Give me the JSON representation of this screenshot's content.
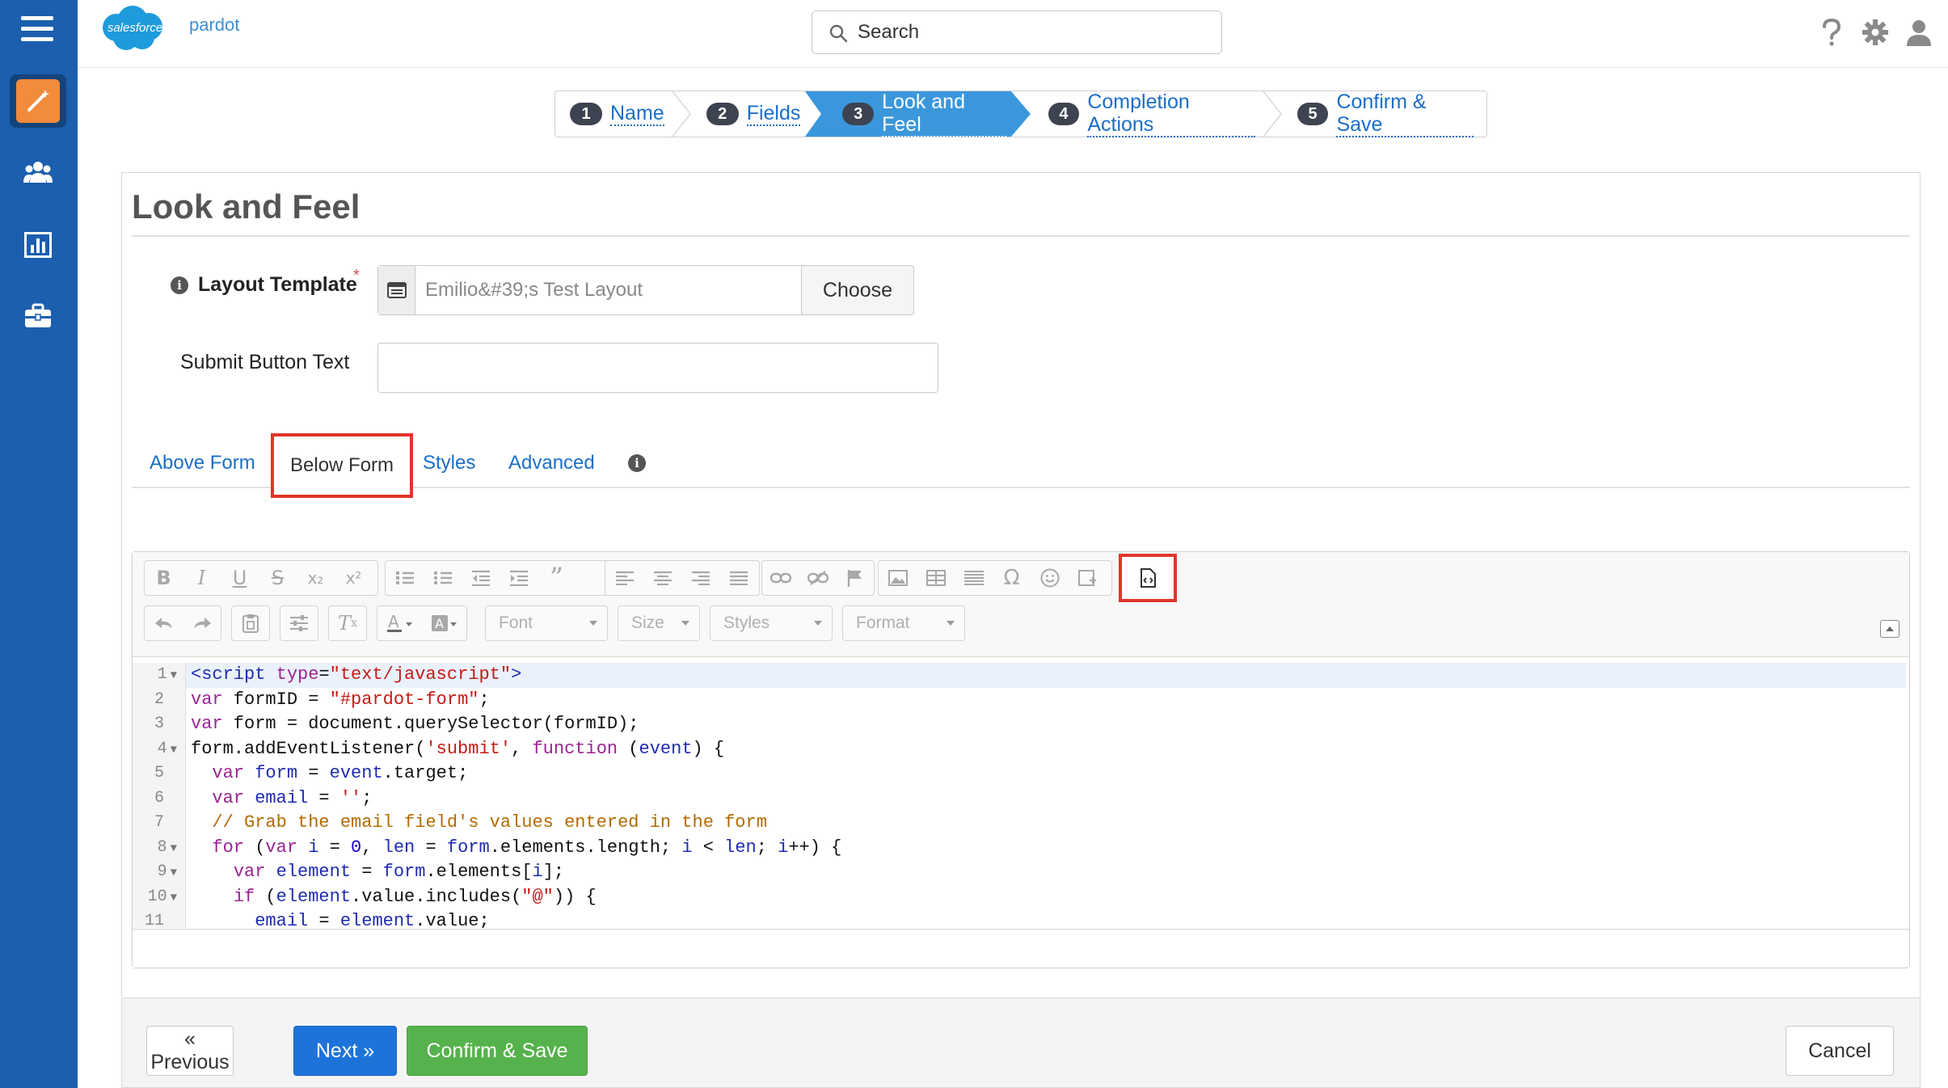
{
  "sidebar": {
    "items": [
      {
        "icon": "wand-icon",
        "active": true
      },
      {
        "icon": "users-icon",
        "active": false
      },
      {
        "icon": "bar-chart-icon",
        "active": false
      },
      {
        "icon": "briefcase-icon",
        "active": false
      }
    ]
  },
  "header": {
    "logo_cloud_text": "salesforce",
    "logo_brand": "pardot",
    "search_placeholder": "Search"
  },
  "wizard": {
    "steps": [
      {
        "num": "1",
        "label": "Name"
      },
      {
        "num": "2",
        "label": "Fields"
      },
      {
        "num": "3",
        "label": "Look and Feel"
      },
      {
        "num": "4",
        "label": "Completion Actions"
      },
      {
        "num": "5",
        "label": "Confirm & Save"
      }
    ],
    "active_step": 3
  },
  "panel": {
    "title": "Look and Feel",
    "layout_template_label": "Layout Template",
    "required_mark": "*",
    "layout_template_value": "Emilio&#39;s Test Layout",
    "choose_label": "Choose",
    "submit_button_label": "Submit Button Text",
    "submit_button_value": ""
  },
  "tabs": {
    "above": "Above Form",
    "below": "Below Form",
    "styles": "Styles",
    "advanced": "Advanced"
  },
  "toolbar": {
    "font": "Font",
    "size": "Size",
    "styles": "Styles",
    "format": "Format"
  },
  "code": {
    "line_numbers": [
      "1",
      "2",
      "3",
      "4",
      "5",
      "6",
      "7",
      "8",
      "9",
      "10",
      "11"
    ]
  },
  "footer": {
    "previous": "« Previous",
    "next": "Next »",
    "confirm": "Confirm & Save",
    "cancel": "Cancel"
  },
  "colors": {
    "sidebar": "#1b5fae",
    "accent": "#3b97dc",
    "primary_button": "#1d73d8",
    "success_button": "#56b24c",
    "highlight": "#e0362b"
  }
}
